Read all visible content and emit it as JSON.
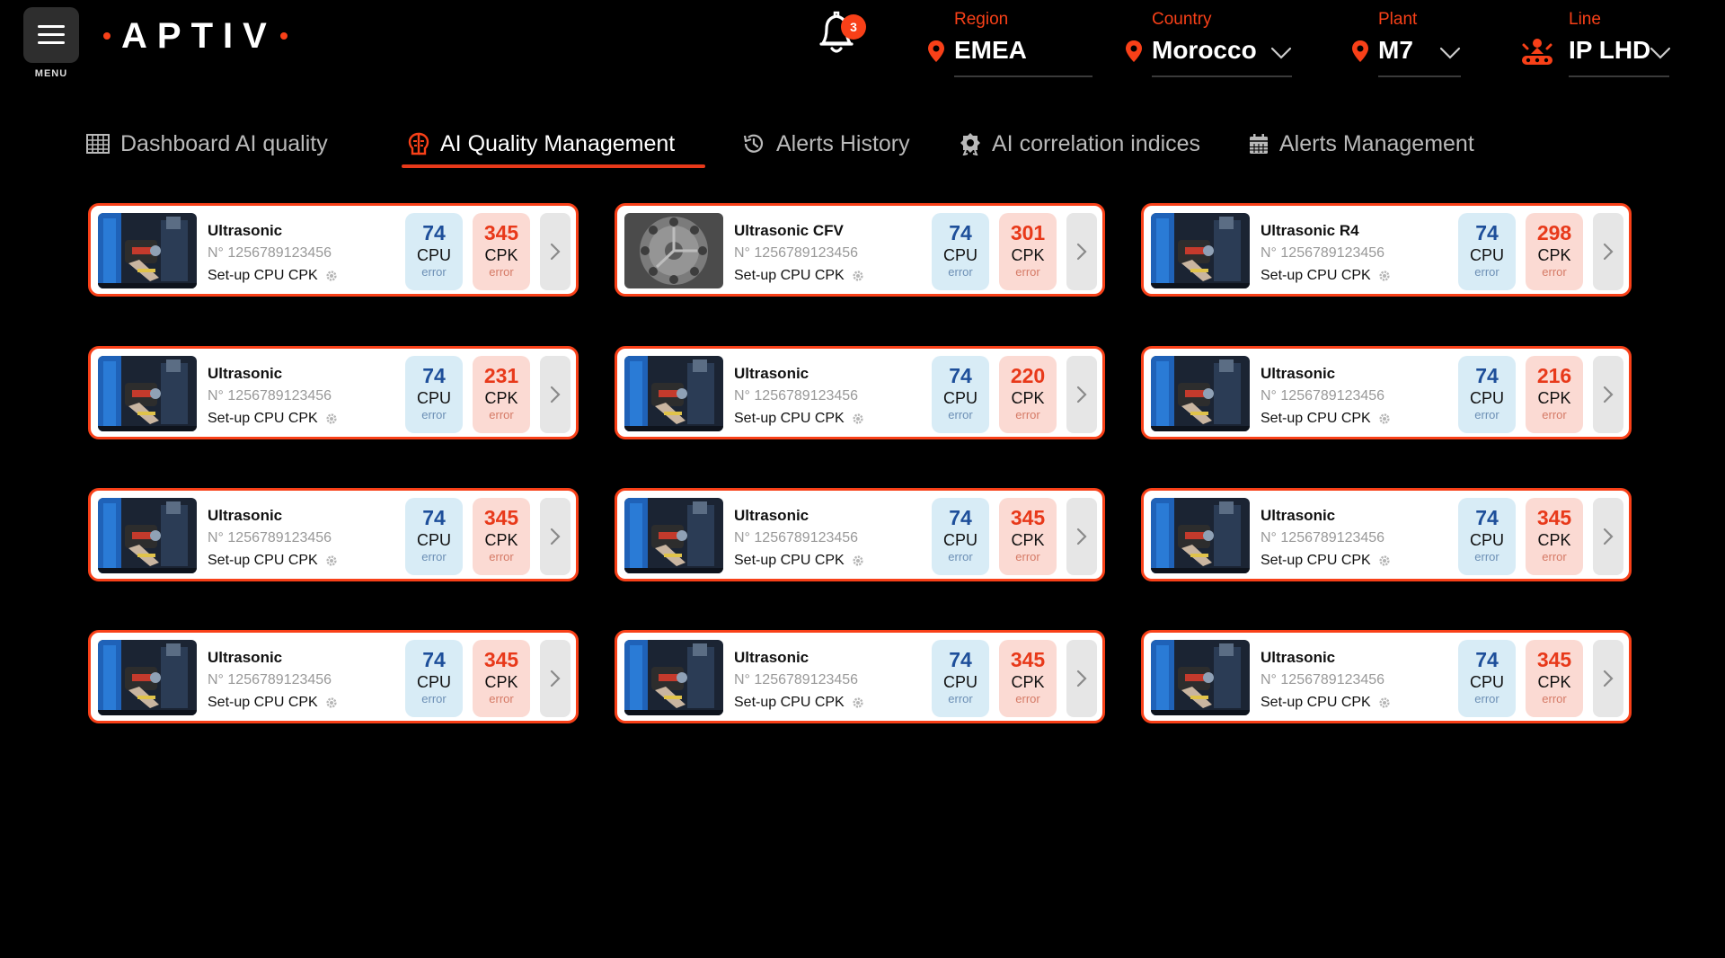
{
  "header": {
    "menu_label": "MENU",
    "logo_text": "APTIV",
    "notifications_count": "3",
    "accent_color": "#f84018"
  },
  "filters": {
    "region": {
      "label": "Region",
      "value": "EMEA",
      "icon": "map-pin-icon"
    },
    "country": {
      "label": "Country",
      "value": "Morocco",
      "icon": "map-pin-icon"
    },
    "plant": {
      "label": "Plant",
      "value": "M7",
      "icon": "map-pin-icon"
    },
    "line": {
      "label": "Line",
      "value": "IP LHD",
      "icon": "robot-arm-icon"
    }
  },
  "tabs": [
    {
      "label": "Dashboard AI quality",
      "icon": "grid-table-icon",
      "active": false
    },
    {
      "label": "AI Quality Management",
      "icon": "brain-icon",
      "active": true
    },
    {
      "label": "Alerts History",
      "icon": "history-icon",
      "active": false
    },
    {
      "label": "AI correlation indices",
      "icon": "badge-gear-icon",
      "active": false
    },
    {
      "label": "Alerts Management",
      "icon": "calendar-icon",
      "active": false
    }
  ],
  "cards": [
    {
      "title": "Ultrasonic",
      "serial": "N° 1256789123456",
      "setup": "Set-up CPU CPK",
      "cpu_value": "74",
      "cpu_label": "CPU",
      "cpu_sub": "error",
      "cpk_value": "345",
      "cpk_label": "CPK",
      "cpk_sub": "error",
      "thumb": "ultrasonic-machine"
    },
    {
      "title": "Ultrasonic CFV",
      "serial": "N° 1256789123456",
      "setup": "Set-up CPU CPK",
      "cpu_value": "74",
      "cpu_label": "CPU",
      "cpu_sub": "error",
      "cpk_value": "301",
      "cpk_label": "CPK",
      "cpk_sub": "error",
      "thumb": "gear-plate"
    },
    {
      "title": "Ultrasonic R4",
      "serial": "N° 1256789123456",
      "setup": "Set-up CPU CPK",
      "cpu_value": "74",
      "cpu_label": "CPU",
      "cpu_sub": "error",
      "cpk_value": "298",
      "cpk_label": "CPK",
      "cpk_sub": "error",
      "thumb": "ultrasonic-machine"
    },
    {
      "title": "Ultrasonic",
      "serial": "N° 1256789123456",
      "setup": "Set-up CPU CPK",
      "cpu_value": "74",
      "cpu_label": "CPU",
      "cpu_sub": "error",
      "cpk_value": "231",
      "cpk_label": "CPK",
      "cpk_sub": "error",
      "thumb": "ultrasonic-machine"
    },
    {
      "title": "Ultrasonic",
      "serial": "N° 1256789123456",
      "setup": "Set-up CPU CPK",
      "cpu_value": "74",
      "cpu_label": "CPU",
      "cpu_sub": "error",
      "cpk_value": "220",
      "cpk_label": "CPK",
      "cpk_sub": "error",
      "thumb": "ultrasonic-machine"
    },
    {
      "title": "Ultrasonic",
      "serial": "N° 1256789123456",
      "setup": "Set-up CPU CPK",
      "cpu_value": "74",
      "cpu_label": "CPU",
      "cpu_sub": "error",
      "cpk_value": "216",
      "cpk_label": "CPK",
      "cpk_sub": "error",
      "thumb": "ultrasonic-machine"
    },
    {
      "title": "Ultrasonic",
      "serial": "N° 1256789123456",
      "setup": "Set-up CPU CPK",
      "cpu_value": "74",
      "cpu_label": "CPU",
      "cpu_sub": "error",
      "cpk_value": "345",
      "cpk_label": "CPK",
      "cpk_sub": "error",
      "thumb": "ultrasonic-machine"
    },
    {
      "title": "Ultrasonic",
      "serial": "N° 1256789123456",
      "setup": "Set-up CPU CPK",
      "cpu_value": "74",
      "cpu_label": "CPU",
      "cpu_sub": "error",
      "cpk_value": "345",
      "cpk_label": "CPK",
      "cpk_sub": "error",
      "thumb": "ultrasonic-machine"
    },
    {
      "title": "Ultrasonic",
      "serial": "N° 1256789123456",
      "setup": "Set-up CPU CPK",
      "cpu_value": "74",
      "cpu_label": "CPU",
      "cpu_sub": "error",
      "cpk_value": "345",
      "cpk_label": "CPK",
      "cpk_sub": "error",
      "thumb": "ultrasonic-machine"
    },
    {
      "title": "Ultrasonic",
      "serial": "N° 1256789123456",
      "setup": "Set-up CPU CPK",
      "cpu_value": "74",
      "cpu_label": "CPU",
      "cpu_sub": "error",
      "cpk_value": "345",
      "cpk_label": "CPK",
      "cpk_sub": "error",
      "thumb": "ultrasonic-machine"
    },
    {
      "title": "Ultrasonic",
      "serial": "N° 1256789123456",
      "setup": "Set-up CPU CPK",
      "cpu_value": "74",
      "cpu_label": "CPU",
      "cpu_sub": "error",
      "cpk_value": "345",
      "cpk_label": "CPK",
      "cpk_sub": "error",
      "thumb": "ultrasonic-machine"
    },
    {
      "title": "Ultrasonic",
      "serial": "N° 1256789123456",
      "setup": "Set-up CPU CPK",
      "cpu_value": "74",
      "cpu_label": "CPU",
      "cpu_sub": "error",
      "cpk_value": "345",
      "cpk_label": "CPK",
      "cpk_sub": "error",
      "thumb": "ultrasonic-machine"
    }
  ]
}
